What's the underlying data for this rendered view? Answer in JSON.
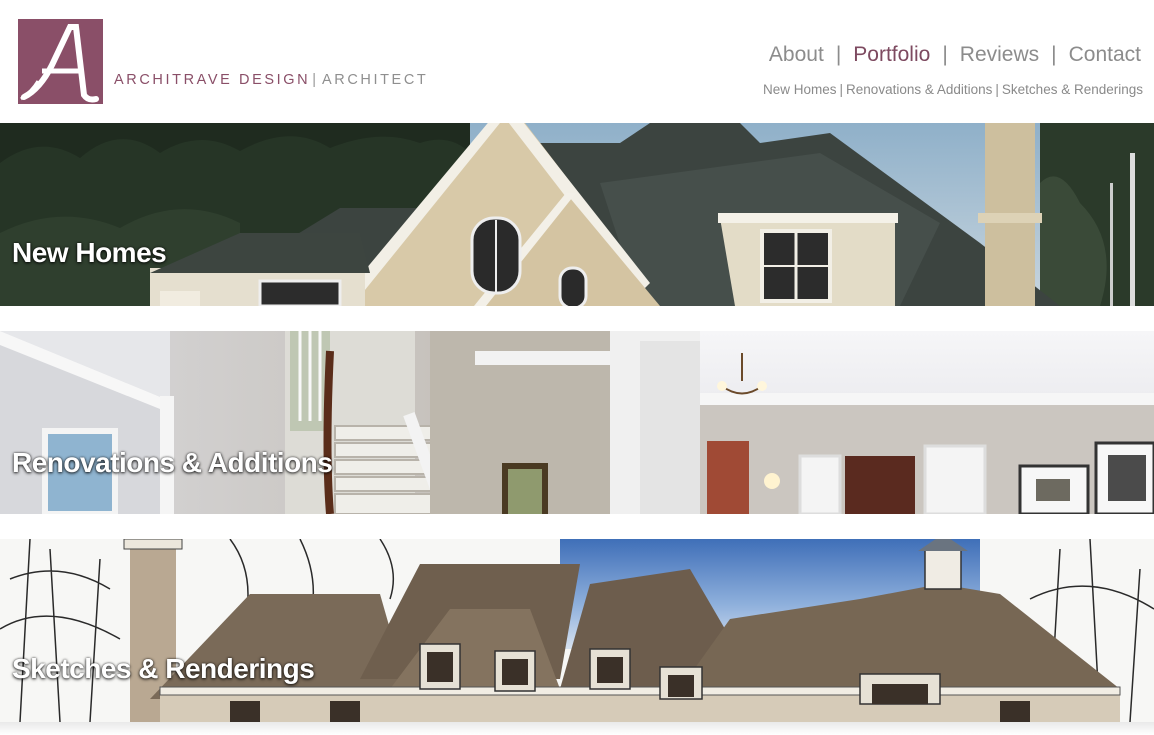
{
  "brand": {
    "logo_letter": "A",
    "name": "ARCHITRAVE DESIGN",
    "separator": "|",
    "tagline": "ARCHITECT",
    "color": "#8a4f68"
  },
  "main_nav": {
    "items": [
      {
        "label": "About"
      },
      {
        "label": "Portfolio",
        "active": true
      },
      {
        "label": "Reviews"
      },
      {
        "label": "Contact"
      }
    ],
    "separator": "|"
  },
  "sub_nav": {
    "items": [
      {
        "label": "New Homes"
      },
      {
        "label": "Renovations & Additions"
      },
      {
        "label": "Sketches & Renderings"
      }
    ],
    "separator": "|"
  },
  "banners": [
    {
      "title": "New Homes",
      "image": "stone-house-photo"
    },
    {
      "title": "Renovations & Additions",
      "image": "interior-hallway-photo"
    },
    {
      "title": "Sketches & Renderings",
      "image": "house-sketch-rendering"
    }
  ]
}
